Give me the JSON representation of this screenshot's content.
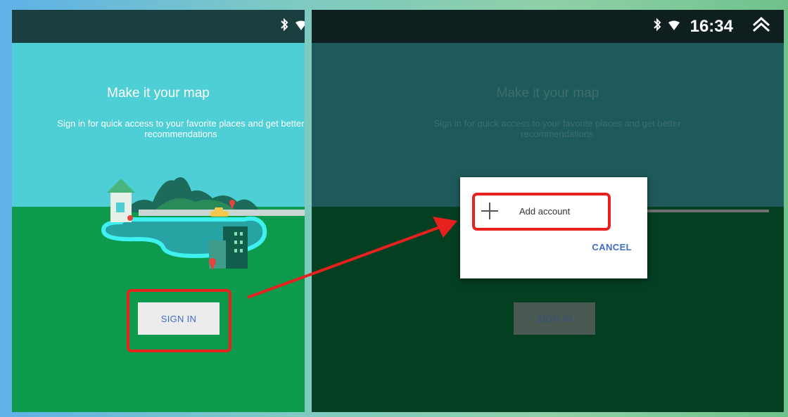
{
  "left_screen": {
    "headline": "Make it your map",
    "subline": "Sign in for quick access to your favorite places and get better recommendations",
    "sign_in_label": "SIGN IN"
  },
  "right_screen": {
    "status_time": "16:34",
    "headline": "Make it your map",
    "subline": "Sign in for quick access to your favorite places and get better recommendations",
    "sign_in_label": "SIGN IN",
    "dialog": {
      "add_account_label": "Add account",
      "cancel_label": "CANCEL"
    }
  },
  "colors": {
    "annotation_red": "#e8201e",
    "sky": "#4dcfd5",
    "ground": "#0e9a4c",
    "link_blue": "#3e6cc9"
  },
  "icons": [
    "bluetooth-icon",
    "wifi-icon",
    "collapse-chevron-icon",
    "plus-icon",
    "map-pin-icon",
    "taxi-icon"
  ]
}
